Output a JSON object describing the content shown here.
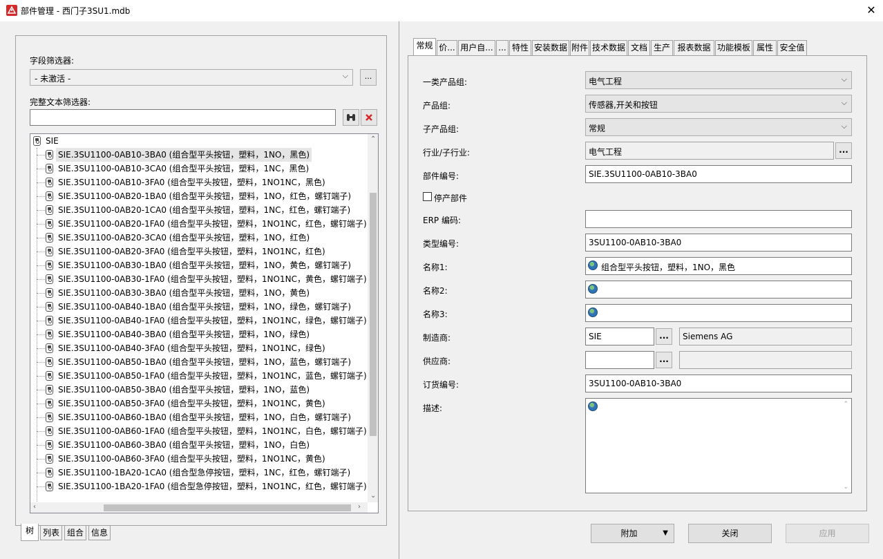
{
  "window": {
    "title": "部件管理 - 西门子3SU1.mdb",
    "close_symbol": "✕"
  },
  "left": {
    "field_filter_label": "字段筛选器:",
    "field_filter_value": "- 未激活 -",
    "field_filter_more": "...",
    "text_filter_label": "完整文本筛选器:",
    "text_filter_value": "",
    "tree_root": "SIE",
    "tree_items": [
      "SIE.3SU1100-0AB10-3BA0 (组合型平头按钮，塑料，1NO，黑色)",
      "SIE.3SU1100-0AB10-3CA0 (组合型平头按钮，塑料，1NC，黑色)",
      "SIE.3SU1100-0AB10-3FA0 (组合型平头按钮，塑料，1NO1NC，黑色)",
      "SIE.3SU1100-0AB20-1BA0 (组合型平头按钮，塑料，1NO，红色，螺钉端子)",
      "SIE.3SU1100-0AB20-1CA0 (组合型平头按钮，塑料，1NC，红色，螺钉端子)",
      "SIE.3SU1100-0AB20-1FA0 (组合型平头按钮，塑料，1NO1NC，红色，螺钉端子)",
      "SIE.3SU1100-0AB20-3CA0 (组合型平头按钮，塑料，1NO，红色)",
      "SIE.3SU1100-0AB20-3FA0 (组合型平头按钮，塑料，1NO1NC，红色)",
      "SIE.3SU1100-0AB30-1BA0 (组合型平头按钮，塑料，1NO，黄色，螺钉端子)",
      "SIE.3SU1100-0AB30-1FA0 (组合型平头按钮，塑料，1NO1NC，黄色，螺钉端子)",
      "SIE.3SU1100-0AB30-3BA0 (组合型平头按钮，塑料，1NO，黄色)",
      "SIE.3SU1100-0AB40-1BA0 (组合型平头按钮，塑料，1NO，绿色，螺钉端子)",
      "SIE.3SU1100-0AB40-1FA0 (组合型平头按钮，塑料，1NO1NC，绿色，螺钉端子)",
      "SIE.3SU1100-0AB40-3BA0 (组合型平头按钮，塑料，1NO，绿色)",
      "SIE.3SU1100-0AB40-3FA0 (组合型平头按钮，塑料，1NO1NC，绿色)",
      "SIE.3SU1100-0AB50-1BA0 (组合型平头按钮，塑料，1NO，蓝色，螺钉端子)",
      "SIE.3SU1100-0AB50-1FA0 (组合型平头按钮，塑料，1NO1NC，蓝色，螺钉端子)",
      "SIE.3SU1100-0AB50-3BA0 (组合型平头按钮，塑料，1NO，蓝色)",
      "SIE.3SU1100-0AB50-3FA0 (组合型平头按钮，塑料，1NO1NC，黄色)",
      "SIE.3SU1100-0AB60-1BA0 (组合型平头按钮，塑料，1NO，白色，螺钉端子)",
      "SIE.3SU1100-0AB60-1FA0 (组合型平头按钮，塑料，1NO1NC，白色，螺钉端子)",
      "SIE.3SU1100-0AB60-3BA0 (组合型平头按钮，塑料，1NO，白色)",
      "SIE.3SU1100-0AB60-3FA0 (组合型平头按钮，塑料，1NO1NC，黄色)",
      "SIE.3SU1100-1BA20-1CA0 (组合型急停按钮，塑料，1NC，红色，螺钉端子)",
      "SIE.3SU1100-1BA20-1FA0 (组合型急停按钮，塑料，1NO1NC，红色，螺钉端子)"
    ],
    "bottom_tabs": [
      "树",
      "列表",
      "组合",
      "信息"
    ]
  },
  "tabs": [
    "常规",
    "价...",
    "用户自...",
    "...",
    "特性",
    "安装数据",
    "附件",
    "技术数据",
    "文档",
    "生产",
    "报表数据",
    "功能模板",
    "属性",
    "安全值"
  ],
  "form": {
    "product_group_1_label": "一类产品组:",
    "product_group_1_value": "电气工程",
    "product_group_label": "产品组:",
    "product_group_value": "传感器,开关和按钮",
    "sub_product_group_label": "子产品组:",
    "sub_product_group_value": "常规",
    "industry_label": "行业/子行业:",
    "industry_value": "电气工程",
    "part_number_label": "部件编号:",
    "part_number_value": "SIE.3SU1100-0AB10-3BA0",
    "discontinued_label": "停产部件",
    "erp_label": "ERP 编码:",
    "erp_value": "",
    "type_number_label": "类型编号:",
    "type_number_value": "3SU1100-0AB10-3BA0",
    "name1_label": "名称1:",
    "name1_value": "组合型平头按钮，塑料，1NO，黑色",
    "name2_label": "名称2:",
    "name2_value": "",
    "name3_label": "名称3:",
    "name3_value": "",
    "manufacturer_label": "制造商:",
    "manufacturer_code": "SIE",
    "manufacturer_name": "Siemens AG",
    "supplier_label": "供应商:",
    "supplier_code": "",
    "supplier_name": "",
    "order_number_label": "订货编号:",
    "order_number_value": "3SU1100-0AB10-3BA0",
    "description_label": "描述:",
    "description_value": "",
    "ellipsis": "..."
  },
  "buttons": {
    "add": "附加",
    "close": "关闭",
    "apply": "应用"
  }
}
